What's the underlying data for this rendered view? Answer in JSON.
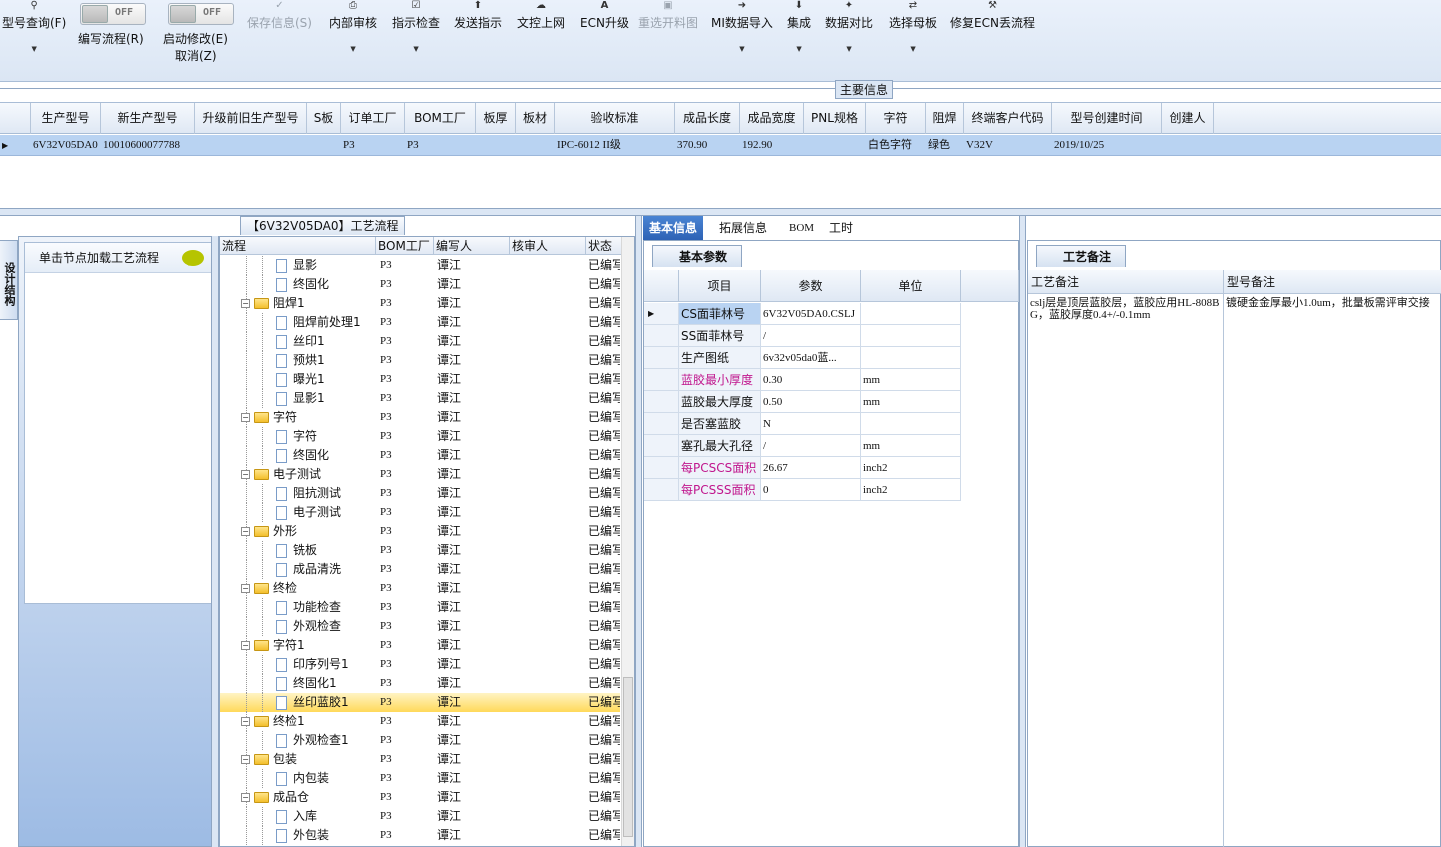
{
  "toolbar": {
    "query": "型号查询(F)",
    "write_flow": "编写流程(R)",
    "start_modify": "启动修改(E)",
    "cancel": "取消(Z)",
    "toggle_off_1": "OFF",
    "toggle_off_2": "OFF",
    "save_info": "保存信息(S)",
    "internal_review": "内部审核",
    "instr_check": "指示检查",
    "send_instr": "发送指示",
    "doc_upload": "文控上网",
    "ecn_upgrade": "ECN升级",
    "reselect_drawing": "重选开料图",
    "mi_import": "MI数据导入",
    "integrate": "集成",
    "data_compare": "数据对比",
    "select_board": "选择母板",
    "fix_ecn": "修复ECN丢流程"
  },
  "main_info_label": "主要信息",
  "top_grid": {
    "headers": [
      "生产型号",
      "新生产型号",
      "升级前旧生产型号",
      "S板",
      "订单工厂",
      "BOM工厂",
      "板厚",
      "板材",
      "验收标准",
      "成品长度",
      "成品宽度",
      "PNL规格",
      "字符",
      "阻焊",
      "终端客户代码",
      "型号创建时间",
      "创建人"
    ],
    "row": [
      "6V32V05DA0",
      "10010600077788",
      "",
      "",
      "P3",
      "P3",
      "",
      "",
      "IPC-6012 II级",
      "370.90",
      "192.90",
      "",
      "白色字符",
      "绿色",
      "V32V",
      "2019/10/25",
      ""
    ]
  },
  "left_panel": {
    "side_tab": "设计结构",
    "hint": "单击节点加载工艺流程"
  },
  "process": {
    "title": "【6V32V05DA0】工艺流程",
    "headers": [
      "流程",
      "BOM工厂",
      "编写人",
      "核审人",
      "状态"
    ],
    "rows": [
      {
        "name": "显影",
        "level": 2,
        "bom": "P3",
        "writer": "谭江",
        "status": "已编写"
      },
      {
        "name": "终固化",
        "level": 2,
        "bom": "P3",
        "writer": "谭江",
        "status": "已编写"
      },
      {
        "name": "阻焊1",
        "level": 1,
        "bom": "P3",
        "writer": "谭江",
        "status": "已编写"
      },
      {
        "name": "阻焊前处理1",
        "level": 2,
        "bom": "P3",
        "writer": "谭江",
        "status": "已编写"
      },
      {
        "name": "丝印1",
        "level": 2,
        "bom": "P3",
        "writer": "谭江",
        "status": "已编写"
      },
      {
        "name": "预烘1",
        "level": 2,
        "bom": "P3",
        "writer": "谭江",
        "status": "已编写"
      },
      {
        "name": "曝光1",
        "level": 2,
        "bom": "P3",
        "writer": "谭江",
        "status": "已编写"
      },
      {
        "name": "显影1",
        "level": 2,
        "bom": "P3",
        "writer": "谭江",
        "status": "已编写"
      },
      {
        "name": "字符",
        "level": 1,
        "bom": "P3",
        "writer": "谭江",
        "status": "已编写"
      },
      {
        "name": "字符",
        "level": 2,
        "bom": "P3",
        "writer": "谭江",
        "status": "已编写"
      },
      {
        "name": "终固化",
        "level": 2,
        "bom": "P3",
        "writer": "谭江",
        "status": "已编写"
      },
      {
        "name": "电子测试",
        "level": 1,
        "bom": "P3",
        "writer": "谭江",
        "status": "已编写"
      },
      {
        "name": "阻抗测试",
        "level": 2,
        "bom": "P3",
        "writer": "谭江",
        "status": "已编写"
      },
      {
        "name": "电子测试",
        "level": 2,
        "bom": "P3",
        "writer": "谭江",
        "status": "已编写"
      },
      {
        "name": "外形",
        "level": 1,
        "bom": "P3",
        "writer": "谭江",
        "status": "已编写"
      },
      {
        "name": "铣板",
        "level": 2,
        "bom": "P3",
        "writer": "谭江",
        "status": "已编写"
      },
      {
        "name": "成品清洗",
        "level": 2,
        "bom": "P3",
        "writer": "谭江",
        "status": "已编写"
      },
      {
        "name": "终检",
        "level": 1,
        "bom": "P3",
        "writer": "谭江",
        "status": "已编写"
      },
      {
        "name": "功能检查",
        "level": 2,
        "bom": "P3",
        "writer": "谭江",
        "status": "已编写"
      },
      {
        "name": "外观检查",
        "level": 2,
        "bom": "P3",
        "writer": "谭江",
        "status": "已编写"
      },
      {
        "name": "字符1",
        "level": 1,
        "bom": "P3",
        "writer": "谭江",
        "status": "已编写"
      },
      {
        "name": "印序列号1",
        "level": 2,
        "bom": "P3",
        "writer": "谭江",
        "status": "已编写"
      },
      {
        "name": "终固化1",
        "level": 2,
        "bom": "P3",
        "writer": "谭江",
        "status": "已编写"
      },
      {
        "name": "丝印蓝胶1",
        "level": 2,
        "bom": "P3",
        "writer": "谭江",
        "status": "已编写",
        "selected": true
      },
      {
        "name": "终检1",
        "level": 1,
        "bom": "P3",
        "writer": "谭江",
        "status": "已编写"
      },
      {
        "name": "外观检查1",
        "level": 2,
        "bom": "P3",
        "writer": "谭江",
        "status": "已编写"
      },
      {
        "name": "包装",
        "level": 1,
        "bom": "P3",
        "writer": "谭江",
        "status": "已编写"
      },
      {
        "name": "内包装",
        "level": 2,
        "bom": "P3",
        "writer": "谭江",
        "status": "已编写"
      },
      {
        "name": "成品仓",
        "level": 1,
        "bom": "P3",
        "writer": "谭江",
        "status": "已编写"
      },
      {
        "name": "入库",
        "level": 2,
        "bom": "P3",
        "writer": "谭江",
        "status": "已编写"
      },
      {
        "name": "外包装",
        "level": 2,
        "bom": "P3",
        "writer": "谭江",
        "status": "已编写"
      }
    ]
  },
  "tabs": [
    "基本信息",
    "拓展信息",
    "BOM",
    "工时"
  ],
  "basic": {
    "title": "基本参数",
    "headers": [
      "项目",
      "参数",
      "单位"
    ],
    "rows": [
      {
        "item": "CS面菲林号",
        "value": "6V32V05DA0.CSLJ",
        "unit": "",
        "style": "hl"
      },
      {
        "item": "SS面菲林号",
        "value": "/",
        "unit": "",
        "style": ""
      },
      {
        "item": "生产图纸",
        "value": "6v32v05da0蓝...",
        "unit": "",
        "style": ""
      },
      {
        "item": "蓝胶最小厚度",
        "value": "0.30",
        "unit": "mm",
        "style": "pink"
      },
      {
        "item": "蓝胶最大厚度",
        "value": "0.50",
        "unit": "mm",
        "style": ""
      },
      {
        "item": "是否塞蓝胶",
        "value": "N",
        "unit": "",
        "style": ""
      },
      {
        "item": "塞孔最大孔径",
        "value": "/",
        "unit": "mm",
        "style": ""
      },
      {
        "item": "每PCSCS面积",
        "value": "26.67",
        "unit": "inch2",
        "style": "pink"
      },
      {
        "item": "每PCSSS面积",
        "value": "0",
        "unit": "inch2",
        "style": "pink"
      }
    ]
  },
  "remarks": {
    "title": "工艺备注",
    "headers": [
      "工艺备注",
      "型号备注"
    ],
    "process_remark": "cslj层是顶层蓝胶层，蓝胶应用HL-808BG，蓝胶厚度0.4+/-0.1mm",
    "model_remark": "镀硬金金厚最小1.0um，批量板需评审交接"
  }
}
